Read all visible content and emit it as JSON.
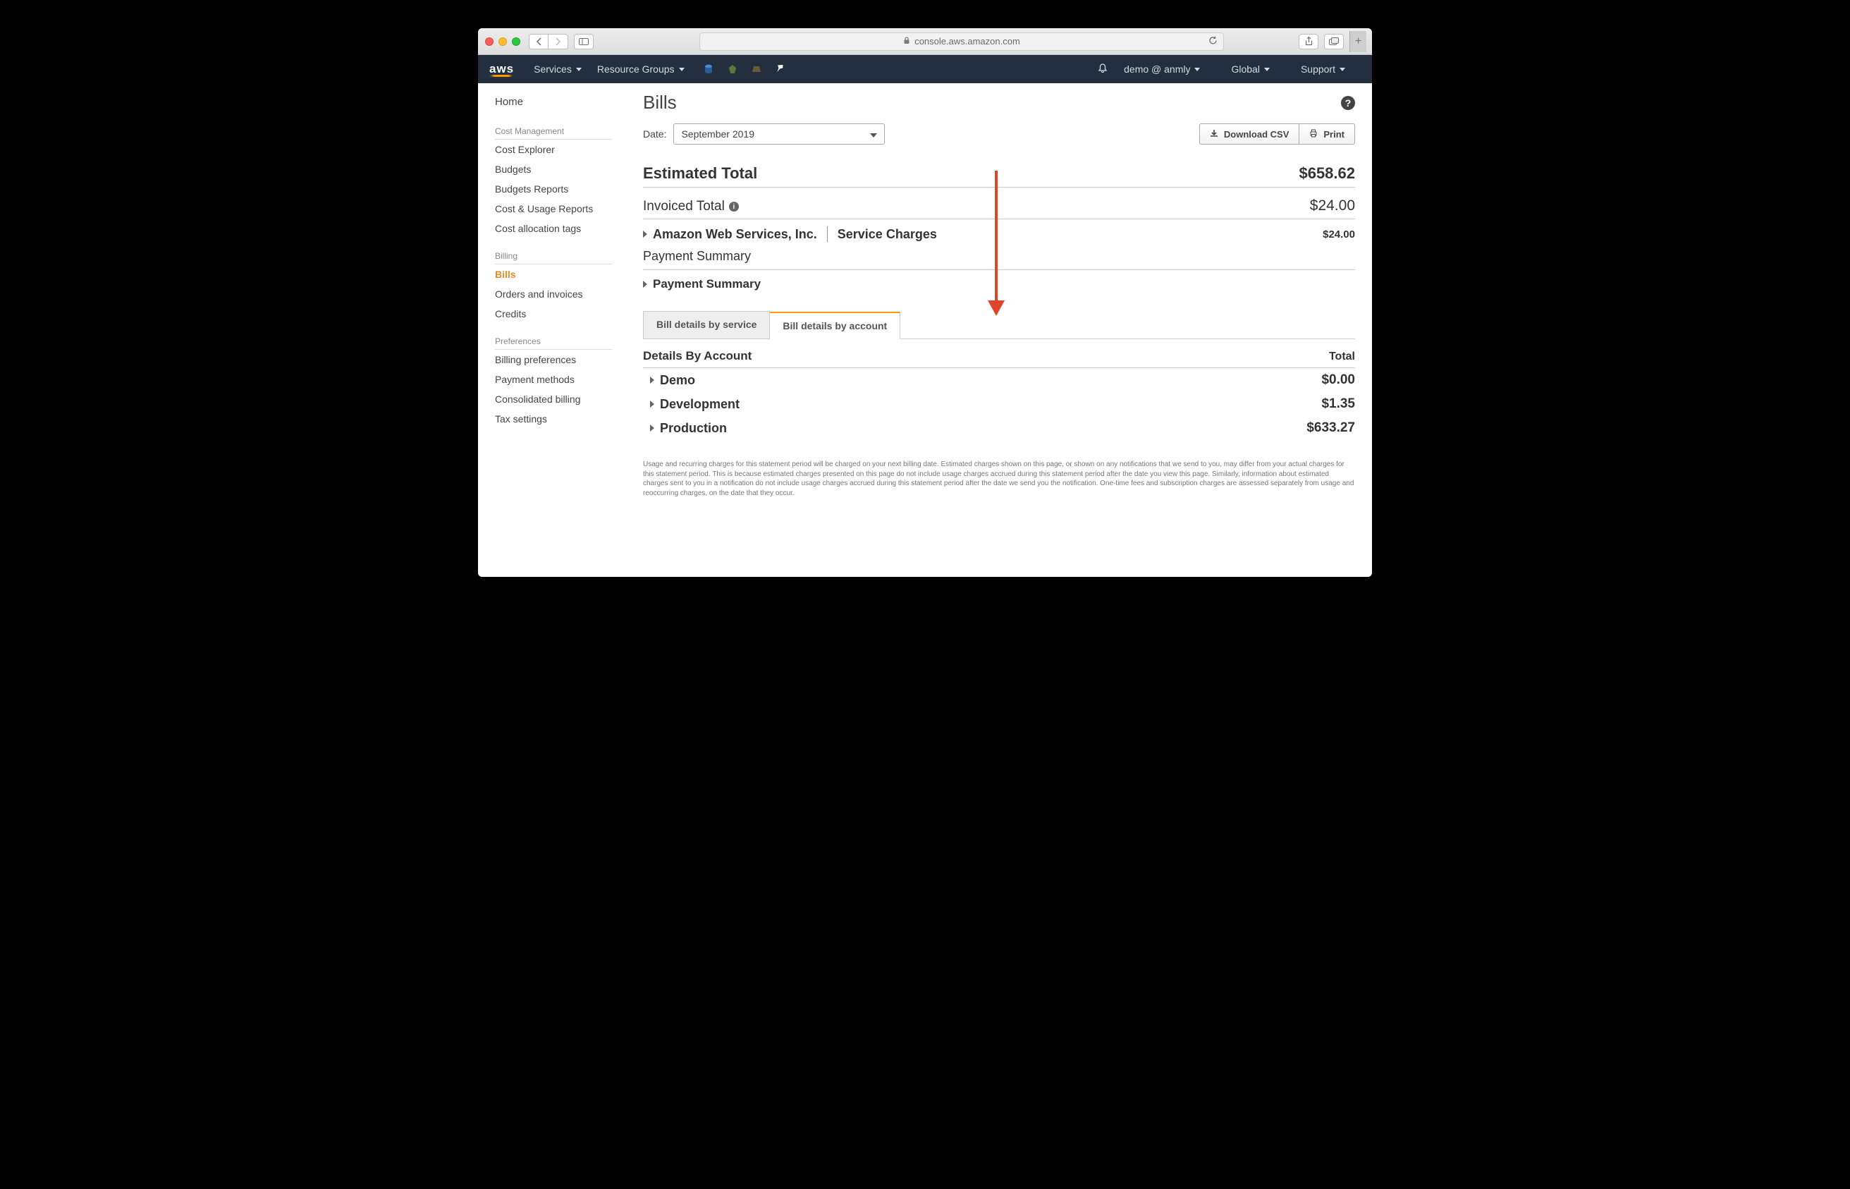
{
  "browser": {
    "url_host": "console.aws.amazon.com"
  },
  "aws_nav": {
    "services": "Services",
    "resource_groups": "Resource Groups",
    "account": "demo @ anmly",
    "region": "Global",
    "support": "Support"
  },
  "sidebar": {
    "home": "Home",
    "sections": [
      {
        "title": "Cost Management",
        "items": [
          "Cost Explorer",
          "Budgets",
          "Budgets Reports",
          "Cost & Usage Reports",
          "Cost allocation tags"
        ]
      },
      {
        "title": "Billing",
        "items": [
          "Bills",
          "Orders and invoices",
          "Credits"
        ],
        "active": "Bills"
      },
      {
        "title": "Preferences",
        "items": [
          "Billing preferences",
          "Payment methods",
          "Consolidated billing",
          "Tax settings"
        ]
      }
    ]
  },
  "main": {
    "title": "Bills",
    "date_label": "Date:",
    "date_value": "September 2019",
    "download_btn": "Download CSV",
    "print_btn": "Print",
    "estimated_label": "Estimated Total",
    "estimated_amount": "$658.62",
    "invoiced_label": "Invoiced Total",
    "invoiced_amount": "$24.00",
    "aws_inc_label": "Amazon Web Services, Inc.",
    "service_charges_label": "Service Charges",
    "service_charges_amount": "$24.00",
    "payment_summary_section": "Payment Summary",
    "payment_summary_row": "Payment Summary",
    "tabs": {
      "by_service": "Bill details by service",
      "by_account": "Bill details by account"
    },
    "details_by_account_header": "Details By Account",
    "total_header": "Total",
    "accounts": [
      {
        "name": "Demo",
        "amount": "$0.00"
      },
      {
        "name": "Development",
        "amount": "$1.35"
      },
      {
        "name": "Production",
        "amount": "$633.27"
      }
    ],
    "disclaimer": "Usage and recurring charges for this statement period will be charged on your next billing date. Estimated charges shown on this page, or shown on any notifications that we send to you, may differ from your actual charges for this statement period. This is because estimated charges presented on this page do not include usage charges accrued during this statement period after the date you view this page. Similarly, information about estimated charges sent to you in a notification do not include usage charges accrued during this statement period after the date we send you the notification. One-time fees and subscription charges are assessed separately from usage and reoccurring charges, on the date that they occur."
  }
}
